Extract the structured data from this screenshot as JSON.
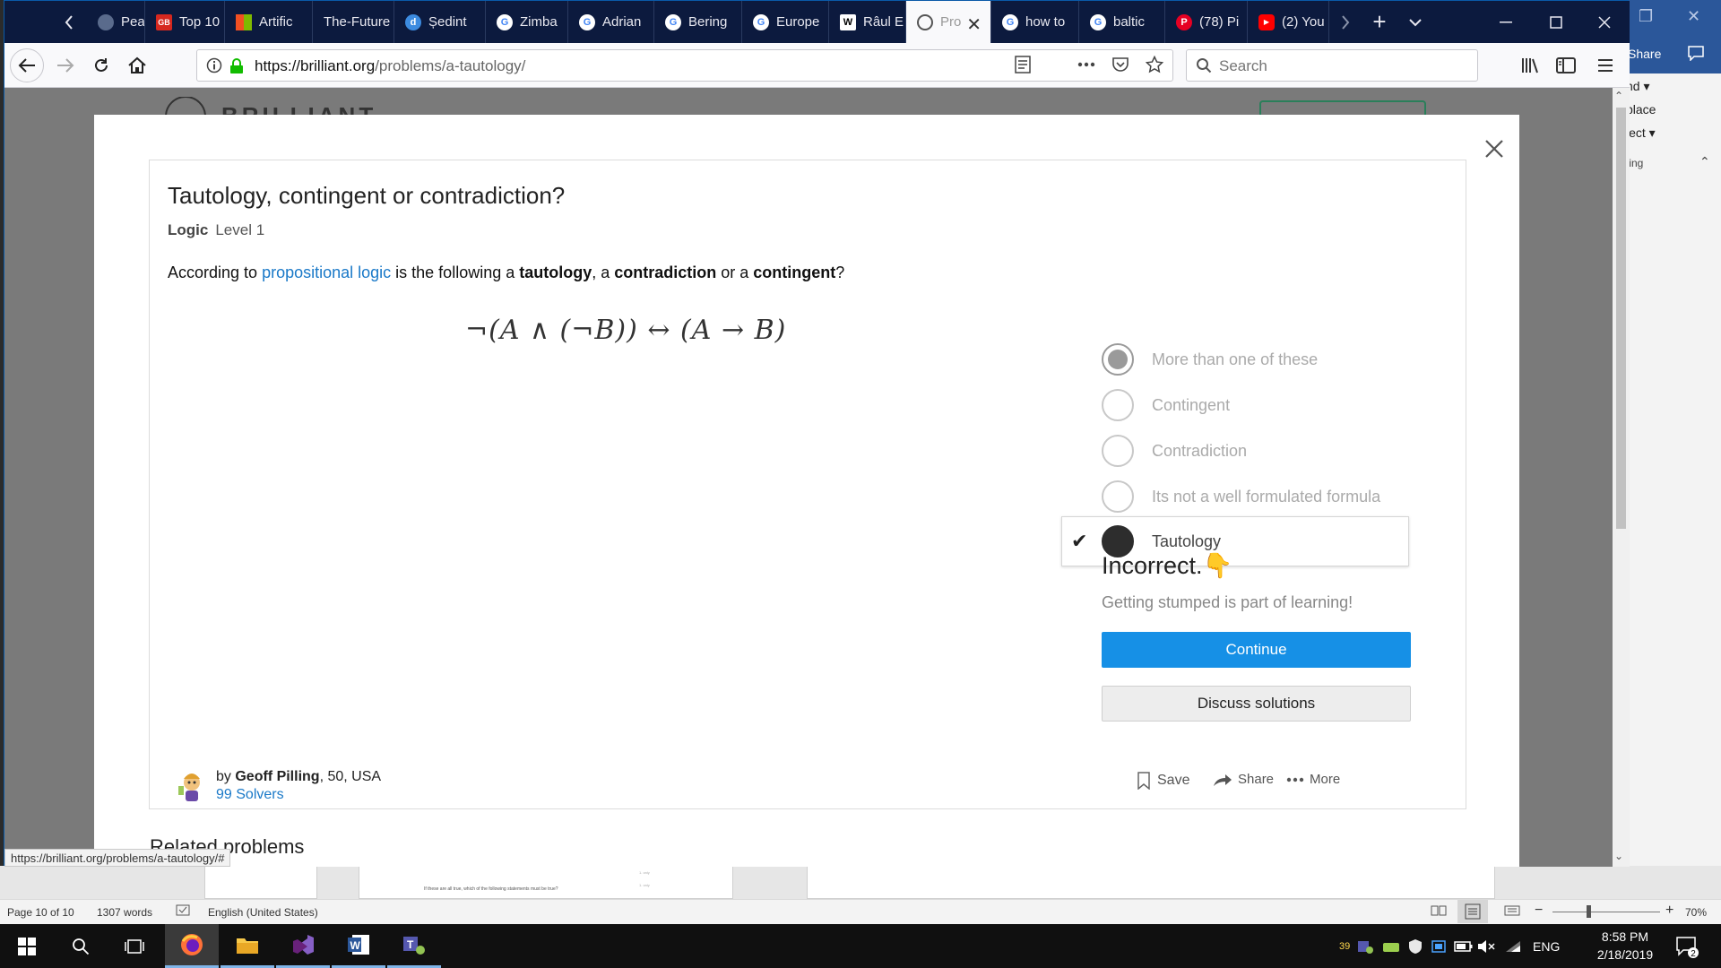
{
  "browser": {
    "tabs": [
      {
        "label": "Pearl H",
        "icon": "page-icon",
        "color": "#5a6b8c"
      },
      {
        "label": "Top 10",
        "icon": "gb-icon",
        "color": "#d6281f"
      },
      {
        "label": "Artific",
        "icon": "windows-logo-icon",
        "color": "#f25022"
      },
      {
        "label": "The-Future",
        "icon": "none",
        "color": "#0c1a3e"
      },
      {
        "label": "Ședint",
        "icon": "d-icon",
        "color": "#3c8be0"
      },
      {
        "label": "Zimba",
        "icon": "google-icon",
        "color": "#ffffff"
      },
      {
        "label": "Adrian",
        "icon": "google-icon",
        "color": "#ffffff"
      },
      {
        "label": "Bering",
        "icon": "google-icon",
        "color": "#ffffff"
      },
      {
        "label": "Europe",
        "icon": "google-icon",
        "color": "#ffffff"
      },
      {
        "label": "Râul E",
        "icon": "wikipedia-icon",
        "color": "#ffffff"
      },
      {
        "label": "Pro",
        "icon": "brilliant-icon",
        "color": "#555555",
        "active": true
      },
      {
        "label": "how to",
        "icon": "google-icon",
        "color": "#ffffff"
      },
      {
        "label": "baltic",
        "icon": "google-icon",
        "color": "#ffffff"
      },
      {
        "label": "(78) Pi",
        "icon": "pinterest-icon",
        "color": "#e60023"
      },
      {
        "label": "(2) You",
        "icon": "youtube-icon",
        "color": "#ff0000"
      }
    ],
    "url_domain": "https://brilliant.org",
    "url_path": "/problems/a-tautology/",
    "search_placeholder": "Search",
    "status_url": "https://brilliant.org/problems/a-tautology/#"
  },
  "problem": {
    "title": "Tautology, contingent or contradiction?",
    "topic": "Logic",
    "level": "Level 1",
    "question_parts": {
      "p1": "According to ",
      "link": "propositional logic",
      "p2": " is the following a ",
      "b1": "tautology",
      "p3": ", a ",
      "b2": "contradiction",
      "p4": " or a ",
      "b3": "contingent",
      "p5": "?"
    },
    "formula": "¬(A ∧ (¬B)) ↔ (A → B)",
    "choices": [
      {
        "label": "More than one of these",
        "state": "filled-grey"
      },
      {
        "label": "Contingent",
        "state": "empty"
      },
      {
        "label": "Contradiction",
        "state": "empty"
      },
      {
        "label": "Its not a well formulated formula",
        "state": "empty"
      },
      {
        "label": "Tautology",
        "state": "selected"
      }
    ],
    "result_title": "Incorrect.",
    "result_emoji": "👇",
    "result_subtitle": "Getting stumped is part of learning!",
    "continue_label": "Continue",
    "discuss_label": "Discuss solutions",
    "author_prefix": "by ",
    "author_name": "Geoff Pilling",
    "author_suffix": ", 50, USA",
    "solvers": "99 Solvers",
    "save_label": "Save",
    "share_label": "Share",
    "more_label": "More",
    "related_heading": "Related problems"
  },
  "brilliant_logo_text": "BRILLIANT",
  "word": {
    "share": "Share",
    "ribbon_items": [
      "nd",
      "place",
      "lect",
      "ting"
    ],
    "page_status": "Page 10 of 10",
    "word_count": "1307 words",
    "language": "English (United States)",
    "zoom": "70%",
    "preview_line_1": "If these are all true, which of the following statements must be true?",
    "preview_option_1": "1. only",
    "preview_option_2": "1. only"
  },
  "taskbar": {
    "clock_time": "8:58 PM",
    "clock_date": "2/18/2019",
    "lang": "ENG",
    "notification_count": "2",
    "tray_number": "39"
  }
}
